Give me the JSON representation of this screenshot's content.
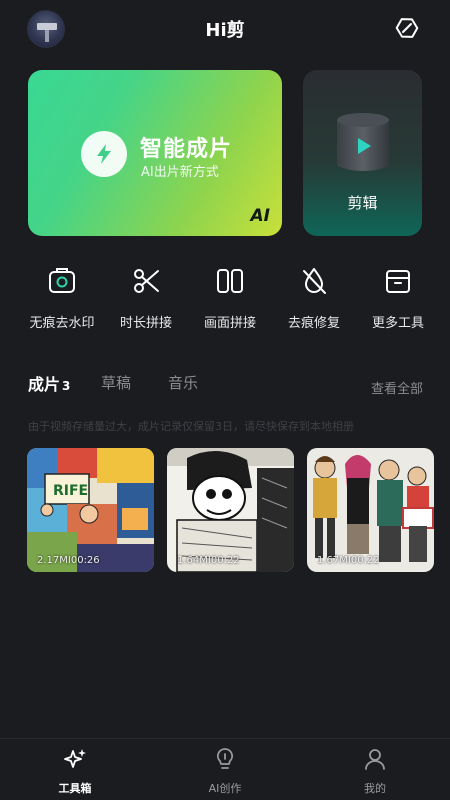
{
  "header": {
    "title": "Hi剪"
  },
  "hero": {
    "smart_title": "智能成片",
    "smart_subtitle": "AI出片新方式",
    "ai_badge": "AI",
    "edit_label": "剪辑"
  },
  "tools": [
    {
      "label": "无痕去水印",
      "icon": "watermark-remove-icon"
    },
    {
      "label": "时长拼接",
      "icon": "scissors-icon"
    },
    {
      "label": "画面拼接",
      "icon": "split-screen-icon"
    },
    {
      "label": "去痕修复",
      "icon": "repair-icon"
    },
    {
      "label": "更多工具",
      "icon": "toolbox-icon"
    }
  ],
  "tabs": [
    {
      "label": "成片",
      "count": "3"
    },
    {
      "label": "草稿"
    },
    {
      "label": "音乐"
    }
  ],
  "view_all": "查看全部",
  "notice": "由于视频存储量过大，成片记录仅保留3日，请尽快保存到本地相册",
  "videos": [
    {
      "size": "2.17M",
      "duration": "00:26",
      "meta": "2.17MI00:26"
    },
    {
      "size": "1.64M",
      "duration": "00:22",
      "meta": "1.64MI00:22"
    },
    {
      "size": "1.67M",
      "duration": "00:22",
      "meta": "1.67MI00:22"
    }
  ],
  "bottom_nav": [
    {
      "label": "工具箱",
      "icon": "sparkle-icon",
      "active": true
    },
    {
      "label": "AI创作",
      "icon": "lightbulb-icon",
      "active": false
    },
    {
      "label": "我的",
      "icon": "person-icon",
      "active": false
    }
  ],
  "colors": {
    "background": "#1b1c1f",
    "smart_gradient_start": "#39d894",
    "smart_gradient_end": "#c9e03a",
    "edit_accent": "#2fd3c2"
  }
}
